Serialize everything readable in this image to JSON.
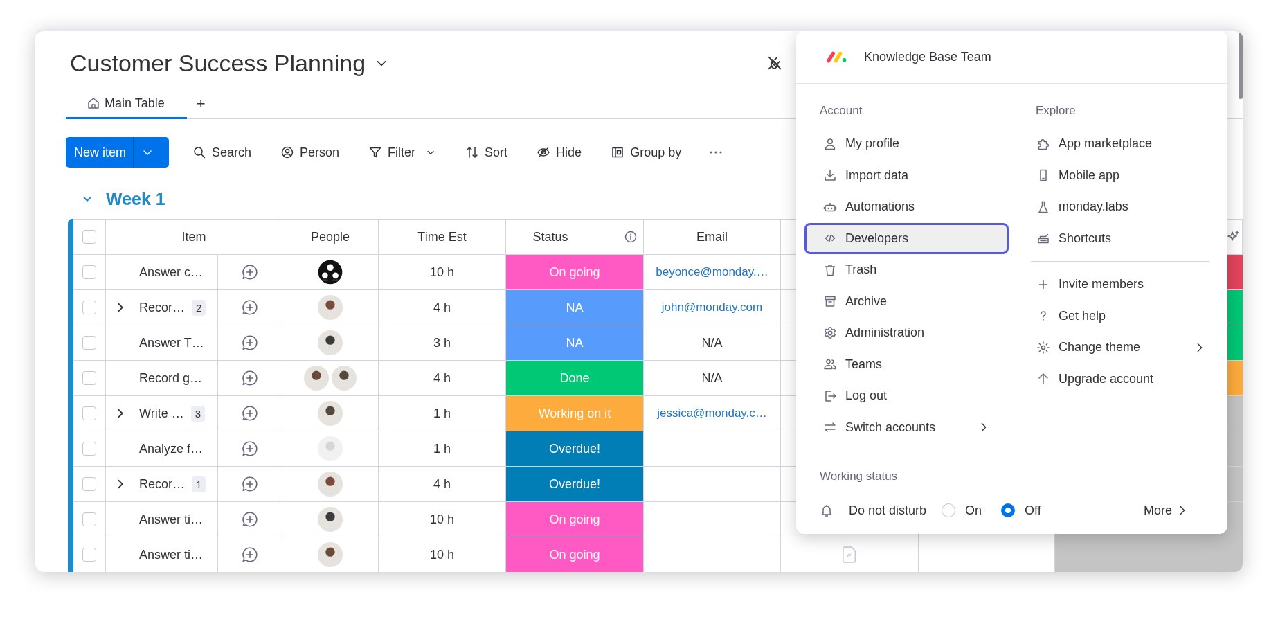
{
  "board": {
    "title": "Customer Success Planning"
  },
  "view_tabs": [
    {
      "label": "Main Table",
      "selected": true
    }
  ],
  "add_view": "+",
  "toolbar": {
    "new_item": "New item",
    "actions": [
      {
        "label": "Search",
        "dropdown": false
      },
      {
        "label": "Person",
        "dropdown": false
      },
      {
        "label": "Filter",
        "dropdown": true
      },
      {
        "label": "Sort",
        "dropdown": false
      },
      {
        "label": "Hide",
        "dropdown": false
      },
      {
        "label": "Group by",
        "dropdown": false
      }
    ]
  },
  "group": {
    "title": "Week 1"
  },
  "table": {
    "header_checked": false,
    "columns": [
      {
        "label": "Item",
        "kind": "plain"
      },
      {
        "label": "People",
        "kind": "plain"
      },
      {
        "label": "Time Est",
        "kind": "plain"
      },
      {
        "label": "Status",
        "kind": "info"
      },
      {
        "label": "Email",
        "kind": "plain"
      }
    ],
    "rows": [
      {
        "checked": false,
        "item": "Answer c…",
        "people": [
          {
            "kind": "group"
          }
        ],
        "time": "10 h",
        "status": {
          "label": "On going",
          "color": "#ff5ac4"
        },
        "email": {
          "text": "beyonce@monday.…",
          "kind": "link"
        },
        "column_9": {
          "color": "#e2445c"
        }
      },
      {
        "checked": false,
        "item": "Recor…",
        "subitems": "2",
        "people": [
          {
            "kind": "photo",
            "faded": false
          }
        ],
        "time": "4 h",
        "status": {
          "label": "NA",
          "color": "#579bfc"
        },
        "email": {
          "text": "john@monday.com",
          "kind": "link"
        },
        "column_9": {
          "color": "#00c875"
        }
      },
      {
        "checked": false,
        "item": "Answer T…",
        "people": [
          {
            "kind": "photo",
            "faded": false
          }
        ],
        "time": "3 h",
        "status": {
          "label": "NA",
          "color": "#579bfc"
        },
        "email": {
          "text": "N/A",
          "kind": "text"
        },
        "column_9": {
          "color": "#00c875"
        }
      },
      {
        "checked": false,
        "item": "Record g…",
        "people": [
          {
            "kind": "photo",
            "faded": false
          },
          {
            "kind": "photo",
            "faded": false
          }
        ],
        "time": "4 h",
        "status": {
          "label": "Done",
          "color": "#00c875"
        },
        "email": {
          "text": "N/A",
          "kind": "text"
        },
        "column_9": {
          "color": "#fdab3d"
        }
      },
      {
        "checked": false,
        "item": "Write …",
        "subitems": "3",
        "people": [
          {
            "kind": "photo",
            "faded": false
          }
        ],
        "time": "1 h",
        "status": {
          "label": "Working on it",
          "color": "#fdab3d"
        },
        "email": {
          "text": "jessica@monday.c…",
          "kind": "link"
        },
        "column_9": {
          "color": "#c4c4c4"
        }
      },
      {
        "checked": false,
        "item": "Analyze f…",
        "people": [
          {
            "kind": "photo",
            "faded": true
          }
        ],
        "time": "1 h",
        "status": {
          "label": "Overdue!",
          "color": "#007eb5"
        },
        "column_9": {
          "color": "#c4c4c4"
        }
      },
      {
        "checked": false,
        "item": "Recor…",
        "subitems": "1",
        "people": [
          {
            "kind": "photo",
            "faded": false
          }
        ],
        "time": "4 h",
        "status": {
          "label": "Overdue!",
          "color": "#007eb5"
        },
        "column_9": {
          "color": "#c4c4c4"
        }
      },
      {
        "checked": false,
        "item": "Answer ti…",
        "people": [
          {
            "kind": "photo",
            "faded": false
          }
        ],
        "time": "10 h",
        "status": {
          "label": "On going",
          "color": "#ff5ac4"
        },
        "column_9": {
          "color": "#c4c4c4"
        }
      },
      {
        "checked": false,
        "item": "Answer ti…",
        "people": [
          {
            "kind": "photo",
            "faded": false
          }
        ],
        "time": "10 h",
        "status": {
          "label": "On going",
          "color": "#ff5ac4"
        },
        "column_7": {
          "kind": "file"
        },
        "column_9": {
          "color": "#c4c4c4"
        }
      }
    ]
  },
  "menu": {
    "team": "Knowledge Base Team",
    "account": {
      "heading": "Account",
      "items": [
        {
          "label": "My profile",
          "selected": false,
          "submenu": false
        },
        {
          "label": "Import data",
          "selected": false,
          "submenu": false
        },
        {
          "label": "Automations",
          "selected": false,
          "submenu": false
        },
        {
          "label": "Developers",
          "selected": true,
          "submenu": false
        },
        {
          "label": "Trash",
          "selected": false,
          "submenu": false
        },
        {
          "label": "Archive",
          "selected": false,
          "submenu": false
        },
        {
          "label": "Administration",
          "selected": false,
          "submenu": false
        },
        {
          "label": "Teams",
          "selected": false,
          "submenu": false
        },
        {
          "label": "Log out",
          "selected": false,
          "submenu": false
        },
        {
          "label": "Switch accounts",
          "selected": false,
          "submenu": true
        }
      ]
    },
    "explore": {
      "heading": "Explore",
      "items": [
        {
          "label": "App marketplace",
          "selected": false,
          "submenu": false
        },
        {
          "label": "Mobile app",
          "selected": false,
          "submenu": false
        },
        {
          "label": "monday.labs",
          "selected": false,
          "submenu": false
        },
        {
          "label": "Shortcuts",
          "selected": false,
          "submenu": false
        }
      ],
      "extra_items": [
        {
          "label": "Invite members",
          "selected": false,
          "submenu": false
        },
        {
          "label": "Get help",
          "selected": false,
          "submenu": false
        },
        {
          "label": "Change theme",
          "selected": false,
          "submenu": true
        },
        {
          "label": "Upgrade account",
          "selected": false,
          "submenu": false
        }
      ]
    },
    "working_status": {
      "heading": "Working status",
      "label": "Do not disturb",
      "options": [
        {
          "label": "On",
          "selected": false
        },
        {
          "label": "Off",
          "selected": true
        }
      ],
      "more": "More"
    }
  }
}
